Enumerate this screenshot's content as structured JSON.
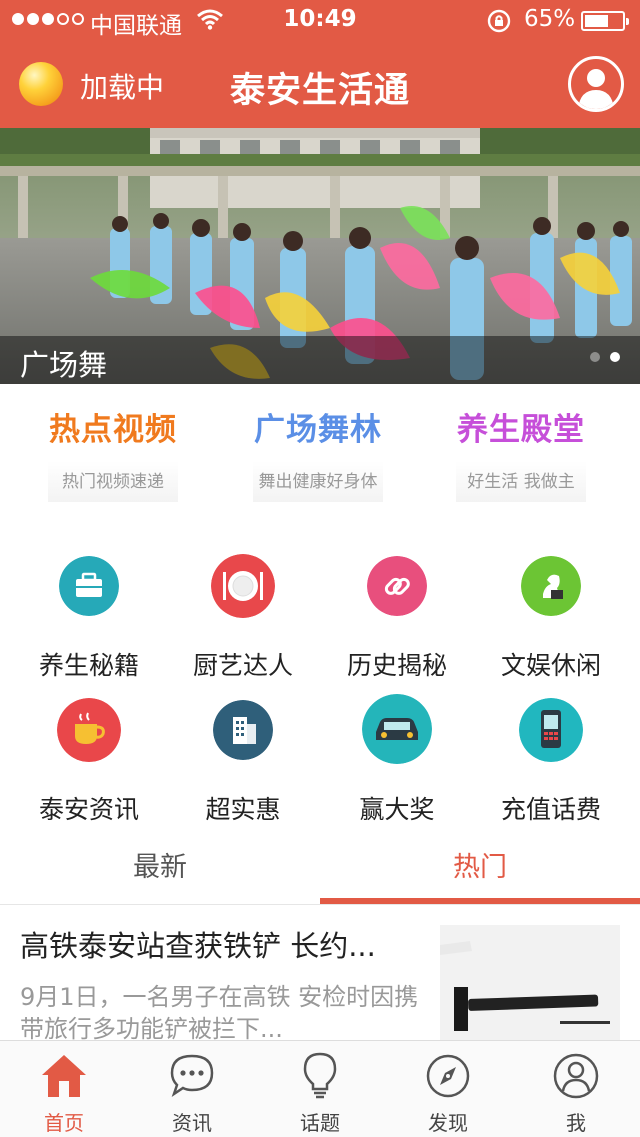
{
  "status_bar": {
    "carrier": "中国联通",
    "time": "10:49",
    "battery_percent_text": "65%",
    "battery_level": 0.65
  },
  "header": {
    "loading_text": "加载中",
    "title": "泰安生活通"
  },
  "banner": {
    "caption": "广场舞",
    "slide_count": 2,
    "active_slide": 2
  },
  "featured": [
    {
      "title": "热点视频",
      "subtitle": "热门视频速递",
      "color": "#f07a1e"
    },
    {
      "title": "广场舞林",
      "subtitle": "舞出健康好身体",
      "color": "#5b8fe6"
    },
    {
      "title": "养生殿堂",
      "subtitle": "好生活  我做主",
      "color": "#c64fd9"
    }
  ],
  "grid": [
    {
      "label": "养生秘籍",
      "icon": "briefcase-icon",
      "color": "#26a9b8"
    },
    {
      "label": "厨艺达人",
      "icon": "plate-icon",
      "color": "#e8484b"
    },
    {
      "label": "历史揭秘",
      "icon": "link-icon",
      "color": "#e84f7d"
    },
    {
      "label": "文娱休闲",
      "icon": "chess-icon",
      "color": "#6cc534"
    },
    {
      "label": "泰安资讯",
      "icon": "coffee-cup-icon",
      "color": "#e9474a"
    },
    {
      "label": "超实惠",
      "icon": "building-icon",
      "color": "#2f5f7a"
    },
    {
      "label": "赢大奖",
      "icon": "car-icon",
      "color": "#24b5ba"
    },
    {
      "label": "充值话费",
      "icon": "phone-icon",
      "color": "#21b7bf"
    }
  ],
  "tabs": [
    {
      "label": "最新",
      "active": false
    },
    {
      "label": "热门",
      "active": true
    }
  ],
  "news": [
    {
      "title": "高铁泰安站查获铁铲 长约...",
      "summary": "9月1日，一名男子在高铁 安检时因携带旅行多功能铲被拦下..."
    }
  ],
  "bottom_nav": [
    {
      "label": "首页",
      "icon": "home-icon",
      "active": true
    },
    {
      "label": "资讯",
      "icon": "chat-bubble-icon",
      "active": false
    },
    {
      "label": "话题",
      "icon": "lightbulb-icon",
      "active": false
    },
    {
      "label": "发现",
      "icon": "compass-icon",
      "active": false
    },
    {
      "label": "我",
      "icon": "user-icon",
      "active": false
    }
  ],
  "colors": {
    "brand": "#e25a45",
    "muted_text": "#999999"
  }
}
